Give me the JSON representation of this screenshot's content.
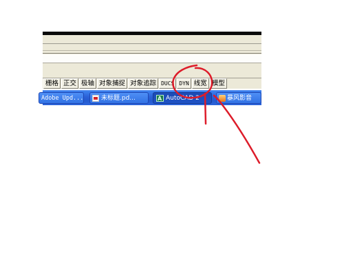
{
  "statusbar": {
    "buttons": [
      {
        "label": "栅格"
      },
      {
        "label": "正交"
      },
      {
        "label": "极轴"
      },
      {
        "label": "对象捕捉"
      },
      {
        "label": "对象追踪"
      },
      {
        "label": "DUCS"
      },
      {
        "label": "DYN"
      },
      {
        "label": "线宽"
      },
      {
        "label": "模型"
      }
    ]
  },
  "taskbar": {
    "items": [
      {
        "label": "Adobe Upd...",
        "icon": "adobe-icon"
      },
      {
        "label": "未标题.pd...",
        "icon": "pdf-icon"
      },
      {
        "label": "AutoCAD 2",
        "icon": "autocad-icon"
      },
      {
        "label": "暴风影音",
        "icon": "media-player-icon"
      }
    ]
  },
  "annotation": {
    "color": "#dd1c2a",
    "shape": "circle-and-arrow"
  }
}
